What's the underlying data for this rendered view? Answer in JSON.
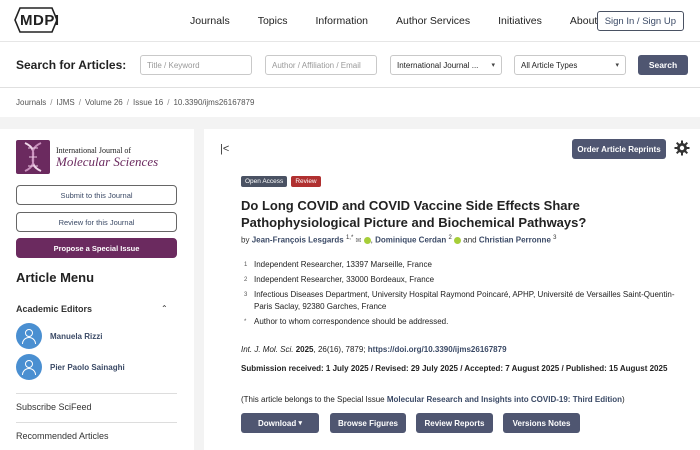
{
  "header": {
    "logo_text": "MDPI",
    "nav": [
      "Journals",
      "Topics",
      "Information",
      "Author Services",
      "Initiatives",
      "About"
    ],
    "signin_label": "Sign In / Sign Up"
  },
  "search": {
    "label": "Search for Articles:",
    "keyword_placeholder": "Title / Keyword",
    "author_placeholder": "Author / Affiliation / Email",
    "journal_value": "International Journal ...",
    "type_value": "All Article Types",
    "button_label": "Search"
  },
  "breadcrumb": [
    "Journals",
    "IJMS",
    "Volume 26",
    "Issue 16",
    "10.3390/ijms26167879"
  ],
  "sidebar": {
    "journal_small": "International Journal of",
    "journal_big": "Molecular Sciences",
    "submit_label": "Submit to this Journal",
    "review_label": "Review for this Journal",
    "propose_label": "Propose a Special Issue",
    "menu_title": "Article Menu",
    "academic_editors_label": "Academic Editors",
    "editors": [
      "Manuela Rizzi",
      "Pier Paolo Sainaghi"
    ],
    "links": [
      "Subscribe SciFeed",
      "Recommended Articles"
    ]
  },
  "article": {
    "order_reprints_label": "Order Article Reprints",
    "badges": [
      "Open Access",
      "Review"
    ],
    "title": "Do Long COVID and COVID Vaccine Side Effects Share Pathophysiological Picture and Biochemical Pathways?",
    "by": "by",
    "authors": [
      {
        "name": "Jean-François Lesgards",
        "sup": "1,*"
      },
      {
        "name": "Dominique Cerdan",
        "sup": "2"
      },
      {
        "name": "Christian Perronne",
        "sup": "3"
      }
    ],
    "and": "and",
    "affiliations": [
      {
        "n": "1",
        "text": "Independent Researcher, 13397 Marseille, France"
      },
      {
        "n": "2",
        "text": "Independent Researcher, 33000 Bordeaux, France"
      },
      {
        "n": "3",
        "text": "Infectious Diseases Department, University Hospital Raymond Poincaré, APHP, Université de Versailles Saint-Quentin-Paris Saclay, 92380 Garches, France"
      },
      {
        "n": "*",
        "text": "Author to whom correspondence should be addressed."
      }
    ],
    "citation_journal": "Int. J. Mol. Sci.",
    "citation_year": "2025",
    "citation_rest": ", 26(16), 7879;",
    "citation_doi": "https://doi.org/10.3390/ijms26167879",
    "dates": "Submission received: 1 July 2025 / Revised: 29 July 2025 / Accepted: 7 August 2025 / Published: 15 August 2025",
    "special_prefix": "(This article belongs to the Special Issue",
    "special_name": "Molecular Research and Insights into COVID-19: Third Edition",
    "special_suffix": ")",
    "buttons": {
      "download": "Download",
      "browse": "Browse Figures",
      "reviews": "Review Reports",
      "versions": "Versions Notes"
    }
  },
  "colors": {
    "brand_purple": "#6b2a5f",
    "button_slate": "#4f5671",
    "link_blue": "#3b4a66",
    "review_red": "#b03030",
    "orcid_green": "#a6ce39"
  }
}
